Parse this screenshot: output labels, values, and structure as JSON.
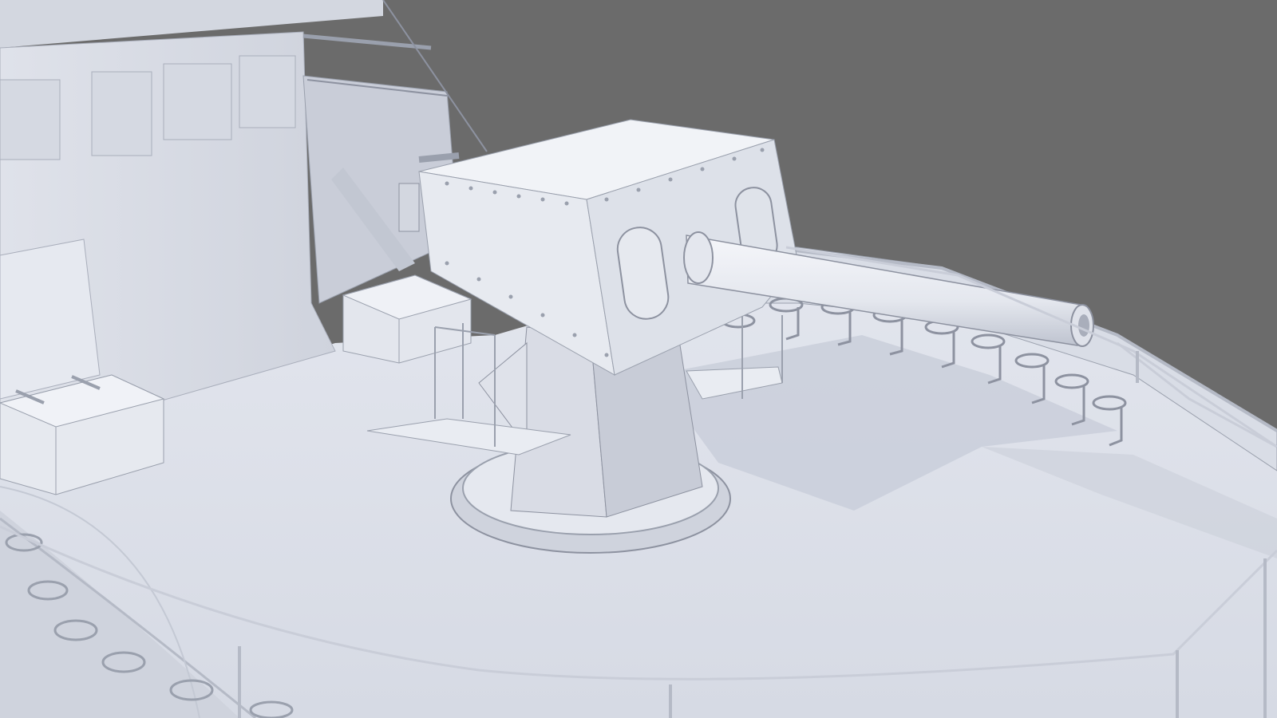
{
  "scene": {
    "subject": "naval-deck-gun-clay-render",
    "colors": {
      "background": "#6b6b6b",
      "deck": "#dde1ea",
      "deck_shadow": "#c6cbd8",
      "metal": "#eef0f5",
      "metal_shade": "#cfd3de",
      "metal_dark": "#a9aebb",
      "outline": "#8d92a0"
    }
  }
}
